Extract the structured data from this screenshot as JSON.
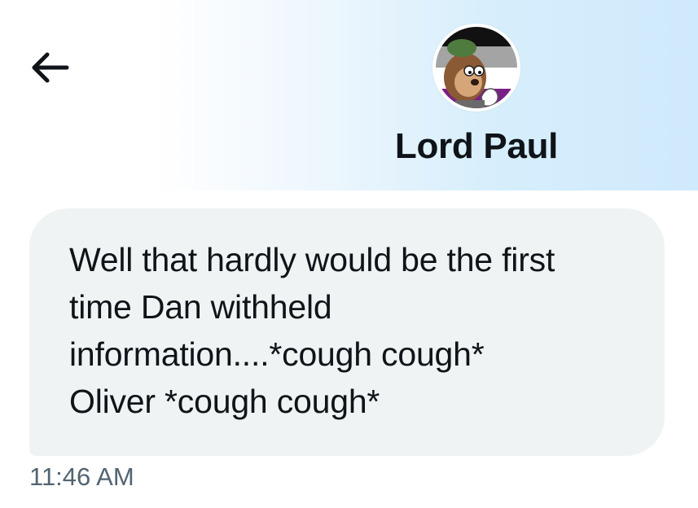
{
  "conversation": {
    "contact_name": "Lord Paul",
    "back_icon": "arrow-left-icon",
    "avatar_icon": "cartoon-avatar-icon",
    "colors": {
      "header_gradient_start": "#ffffff",
      "header_gradient_end": "#cfeafc",
      "bubble_background": "#eff3f4",
      "text": "#0f1419",
      "timestamp": "#536471"
    }
  },
  "message": {
    "text": "Well that hardly would be the first\ntime Dan withheld\ninformation....*cough cough*\nOliver *cough cough*",
    "timestamp": "11:46 AM"
  }
}
